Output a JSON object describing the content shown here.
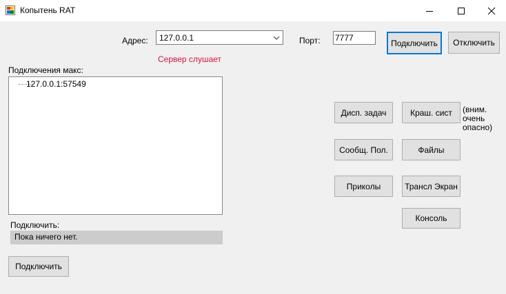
{
  "window": {
    "title": "Копытень RAT"
  },
  "connection": {
    "address_label": "Адрес:",
    "address_value": "127.0.0.1",
    "port_label": "Порт:",
    "port_value": "7777",
    "connect_label": "Подключить",
    "disconnect_label": "Отключить",
    "status_text": "Сервер слушает",
    "status_color": "#d4143a"
  },
  "connections": {
    "header": "Подключения макс:",
    "items": [
      "127.0.0.1:57549"
    ]
  },
  "selected": {
    "label": "Подключить:",
    "value": "Пока ничего нет.",
    "button_label": "Подключить"
  },
  "actions": {
    "task_manager": "Дисп. задач",
    "crash_system": "Краш. сист",
    "crash_note_line1": "(вним. очень",
    "crash_note_line2": "опасно)",
    "message": "Сообщ. Пол.",
    "files": "Файлы",
    "pranks": "Приколы",
    "screen_stream": "Трансл Экран",
    "console": "Консоль"
  },
  "accent_color": "#0078d7"
}
